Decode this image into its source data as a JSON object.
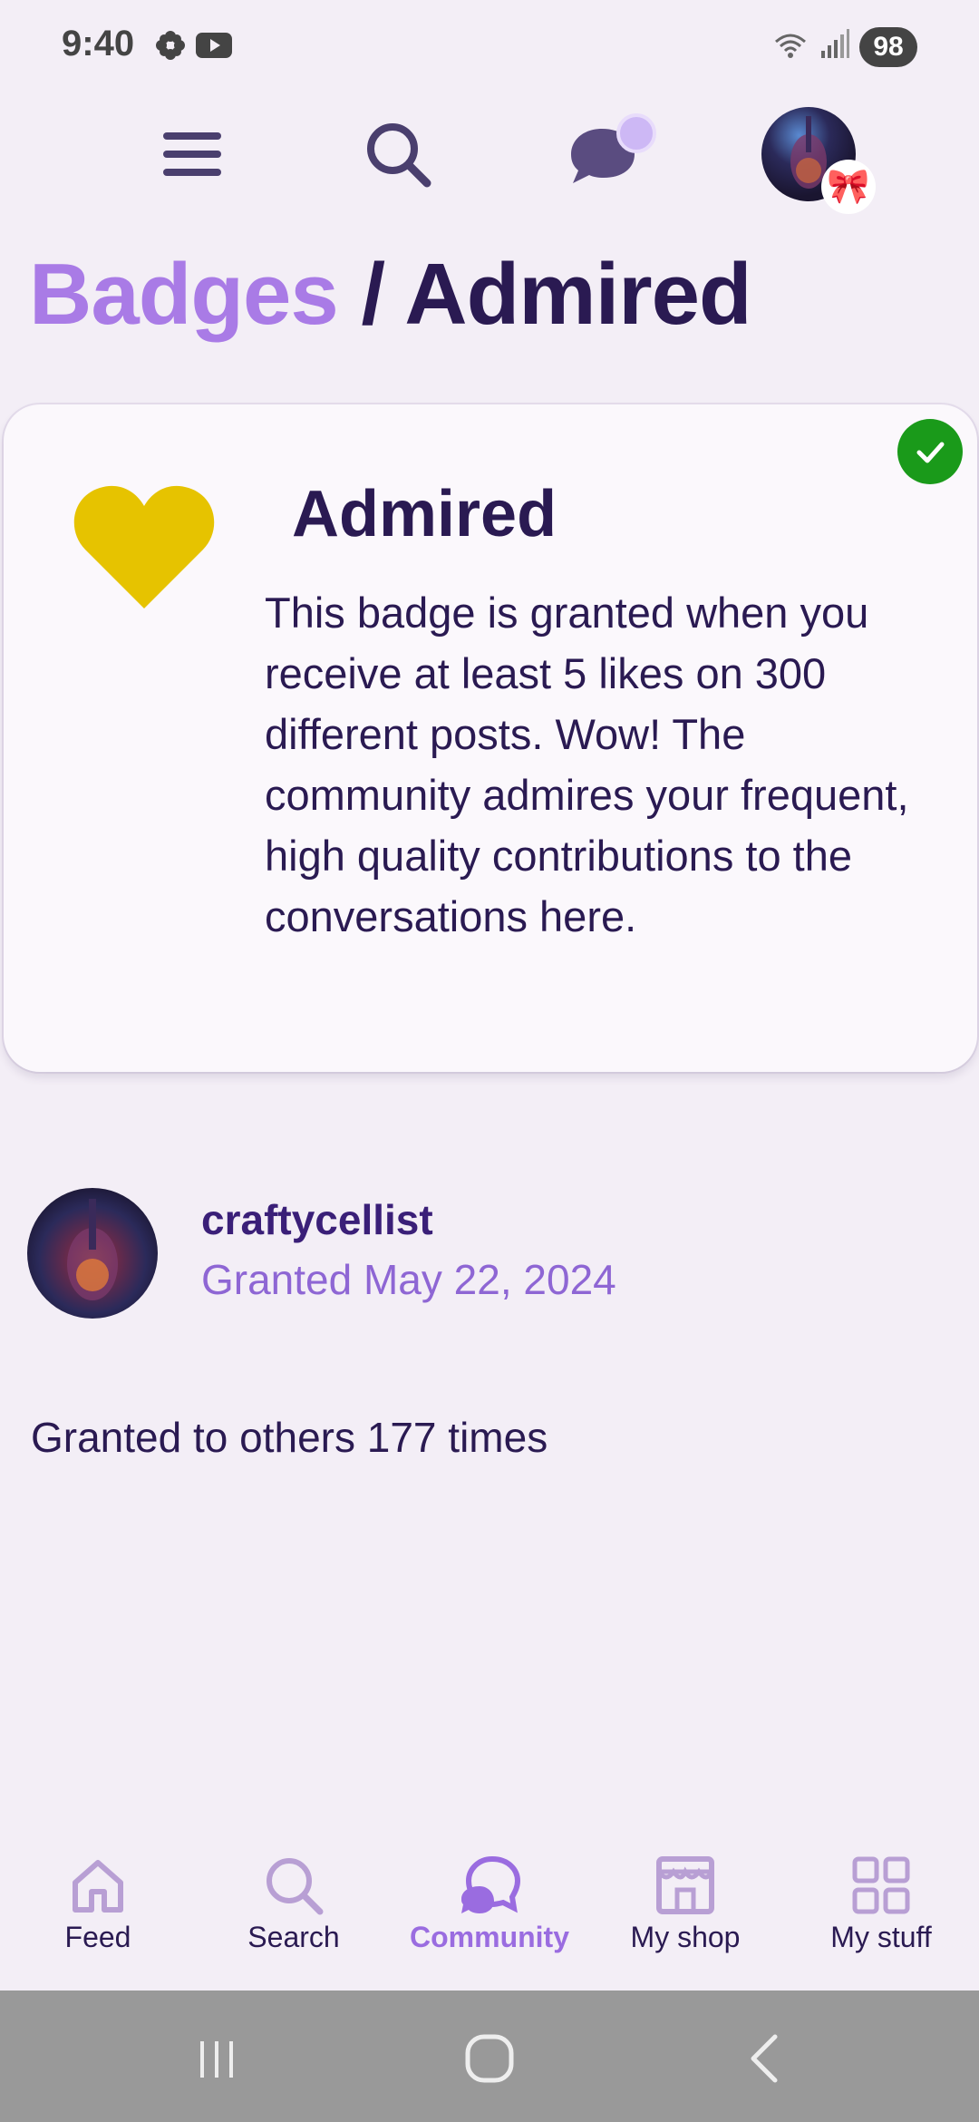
{
  "status": {
    "time": "9:40",
    "battery": "98"
  },
  "breadcrumb": {
    "parent": "Badges",
    "separator": "/",
    "current": "Admired"
  },
  "badge": {
    "name": "Admired",
    "description": "This badge is granted when you receive at least 5 likes on 300 different posts. Wow! The community admires your frequent, high quality contributions to the conversations here.",
    "heart_color": "#e6c300",
    "granted_check_color": "#1a9a1a"
  },
  "grant": {
    "username": "craftycellist",
    "date": "Granted May 22, 2024"
  },
  "others_text": "Granted to others 177 times",
  "bottom_nav": {
    "items": [
      {
        "label": "Feed",
        "icon": "home-icon"
      },
      {
        "label": "Search",
        "icon": "search-icon"
      },
      {
        "label": "Community",
        "icon": "community-icon",
        "active": true
      },
      {
        "label": "My shop",
        "icon": "shop-icon"
      },
      {
        "label": "My stuff",
        "icon": "grid-icon"
      }
    ]
  },
  "colors": {
    "accent": "#a97be6",
    "text": "#2a1a52",
    "background": "#f3eef6"
  }
}
